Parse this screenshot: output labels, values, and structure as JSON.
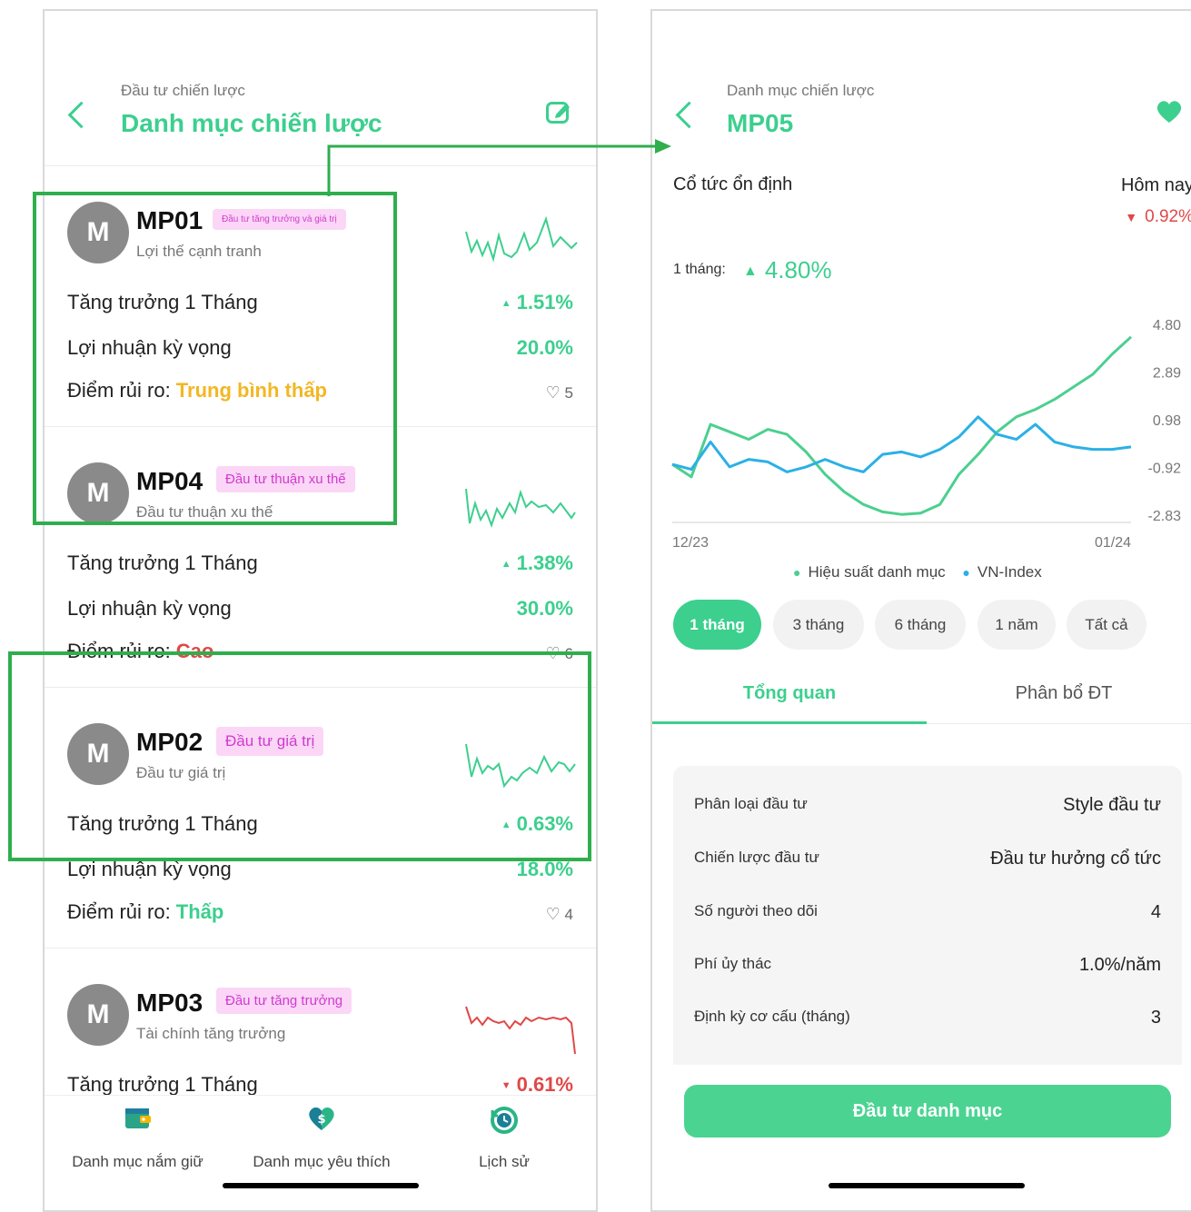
{
  "left": {
    "header": {
      "subtitle": "Đầu tư chiến lược",
      "title": "Danh mục chiến lược"
    },
    "cards": [
      {
        "avatar": "M",
        "code": "MP01",
        "tag": "Đầu tư tăng trưởng và giá trị",
        "subtitle": "Lợi thế cạnh tranh",
        "growth_label": "Tăng trưởng 1 Tháng",
        "growth_value": "1.51%",
        "growth_dir": "up",
        "profit_label": "Lợi nhuận kỳ vọng",
        "profit_value": "20.0%",
        "risk_label": "Điểm rủi ro: ",
        "risk_value": "Trung bình thấp",
        "risk_color": "#f3b723",
        "likes": "5",
        "spark_color": "#3ccf8e"
      },
      {
        "avatar": "M",
        "code": "MP04",
        "tag": "Đầu tư thuận xu thế",
        "subtitle": "Đầu tư thuận xu thế",
        "growth_label": "Tăng trưởng 1 Tháng",
        "growth_value": "1.38%",
        "growth_dir": "up",
        "profit_label": "Lợi nhuận kỳ vọng",
        "profit_value": "30.0%",
        "risk_label": "Điểm rủi ro: ",
        "risk_value": "Cao",
        "risk_color": "#e04848",
        "likes": "6",
        "spark_color": "#3ccf8e"
      },
      {
        "avatar": "M",
        "code": "MP02",
        "tag": "Đầu tư giá trị",
        "subtitle": "Đầu tư giá trị",
        "growth_label": "Tăng trưởng 1 Tháng",
        "growth_value": "0.63%",
        "growth_dir": "up",
        "profit_label": "Lợi nhuận kỳ vọng",
        "profit_value": "18.0%",
        "risk_label": "Điểm rủi ro: ",
        "risk_value": "Thấp",
        "risk_color": "#3ccf8e",
        "likes": "4",
        "spark_color": "#3ccf8e"
      },
      {
        "avatar": "M",
        "code": "MP03",
        "tag": "Đầu tư tăng trưởng",
        "subtitle": "Tài chính tăng trưởng",
        "growth_label": "Tăng trưởng 1 Tháng",
        "growth_value": "0.61%",
        "growth_dir": "down",
        "spark_color": "#e04848"
      }
    ],
    "nav": [
      {
        "label": "Danh mục nắm giữ",
        "icon": "wallet-icon"
      },
      {
        "label": "Danh mục yêu thích",
        "icon": "heart-dollar-icon"
      },
      {
        "label": "Lịch sử",
        "icon": "history-icon"
      }
    ]
  },
  "right": {
    "header": {
      "subtitle": "Danh mục chiến lược",
      "title": "MP05"
    },
    "name": "Cổ tức ổn định",
    "today_label": "Hôm nay",
    "today_value": "0.92%",
    "period_label": "1 tháng:",
    "period_value": "4.80%",
    "chart_data": {
      "type": "line",
      "x_labels": [
        "12/23",
        "01/24"
      ],
      "y_ticks": [
        "4.80",
        "2.89",
        "0.98",
        "-0.92",
        "-2.83"
      ],
      "ylim": [
        -2.83,
        4.8
      ],
      "series": [
        {
          "name": "Hiệu suất danh mục",
          "color": "#4ccf8f",
          "values": [
            -0.8,
            -1.3,
            0.8,
            0.5,
            0.2,
            0.6,
            0.4,
            -0.3,
            -1.2,
            -1.9,
            -2.4,
            -2.7,
            -2.8,
            -2.75,
            -2.4,
            -1.2,
            -0.4,
            0.5,
            1.1,
            1.4,
            1.8,
            2.3,
            2.8,
            3.6,
            4.3
          ]
        },
        {
          "name": "VN-Index",
          "color": "#2bb0e6",
          "values": [
            -0.8,
            -1.0,
            0.1,
            -0.9,
            -0.6,
            -0.7,
            -1.1,
            -0.9,
            -0.6,
            -0.9,
            -1.1,
            -0.4,
            -0.3,
            -0.5,
            -0.2,
            0.3,
            1.1,
            0.4,
            0.2,
            0.8,
            0.1,
            -0.1,
            -0.2,
            -0.2,
            -0.1
          ]
        }
      ]
    },
    "legend": [
      "Hiệu suất danh mục",
      "VN-Index"
    ],
    "periods": [
      "1 tháng",
      "3 tháng",
      "6 tháng",
      "1 năm",
      "Tất cả"
    ],
    "tabs": [
      "Tổng quan",
      "Phân bổ ĐT"
    ],
    "info": [
      {
        "label": "Phân loại đầu tư",
        "value": "Style đầu tư"
      },
      {
        "label": "Chiến lược đầu tư",
        "value": "Đầu tư hưởng cổ tức"
      },
      {
        "label": "Số người theo dõi",
        "value": "4"
      },
      {
        "label": "Phí ủy thác",
        "value": "1.0%/năm"
      },
      {
        "label": "Định kỳ cơ cấu (tháng)",
        "value": "3"
      }
    ],
    "cta": "Đầu tư danh mục"
  }
}
